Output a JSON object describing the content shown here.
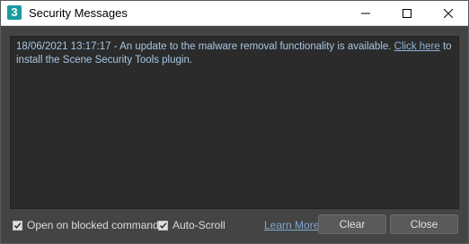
{
  "window": {
    "title": "Security Messages",
    "app_icon_text": "3"
  },
  "message": {
    "text_before_link": "18/06/2021 13:17:17 - An update to the malware removal functionality is available. ",
    "link_text": "Click here",
    "text_after_link": " to install the Scene Security Tools plugin."
  },
  "footer": {
    "open_on_blocked_label": "Open on blocked commands",
    "open_on_blocked_checked": true,
    "auto_scroll_label": "Auto-Scroll",
    "auto_scroll_checked": true,
    "learn_more_label": "Learn More",
    "clear_label": "Clear",
    "close_label": "Close"
  },
  "colors": {
    "background": "#444444",
    "message_background": "#2b2b2b",
    "message_text": "#a9c7e2",
    "link": "#8fb2dc",
    "app_icon": "#1a9aa0"
  }
}
